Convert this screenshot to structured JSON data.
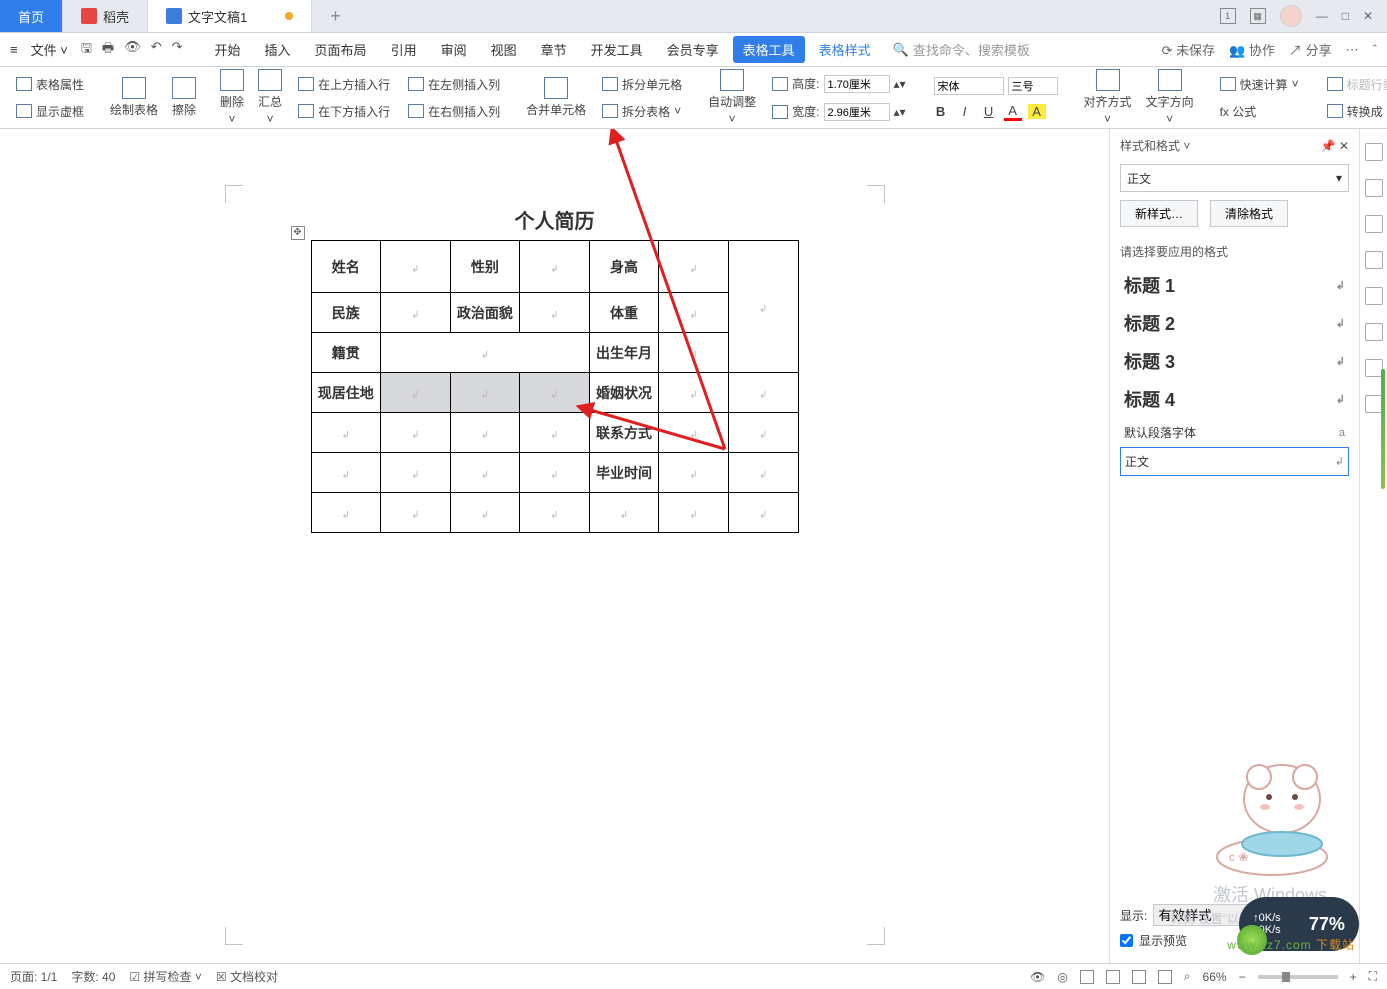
{
  "tabs": {
    "home": "首页",
    "docell": "稻壳",
    "doc": "文字文稿1",
    "add": "+"
  },
  "titlebar_right": {
    "box_num": "1"
  },
  "menubar": {
    "file": "文件",
    "items": [
      "开始",
      "插入",
      "页面布局",
      "引用",
      "审阅",
      "视图",
      "章节",
      "开发工具",
      "会员专享",
      "表格工具",
      "表格样式"
    ],
    "search_ph": "查找命令、搜索模板",
    "right": {
      "unsaved": "未保存",
      "coop": "协作",
      "share": "分享"
    }
  },
  "ribbon": {
    "table_attr": "表格属性",
    "show_border": "显示虚框",
    "draw": "绘制表格",
    "erase": "擦除",
    "delete": "删除",
    "summary": "汇总",
    "ins_top": "在上方插入行",
    "ins_bottom": "在下方插入行",
    "ins_left": "在左侧插入列",
    "ins_right": "在右侧插入列",
    "merge": "合并单元格",
    "split_cell": "拆分单元格",
    "split_table": "拆分表格",
    "auto_adjust": "自动调整",
    "height_lbl": "高度:",
    "height_val": "1.70厘米",
    "width_lbl": "宽度:",
    "width_val": "2.96厘米",
    "font_name": "宋体",
    "font_size": "三号",
    "align": "对齐方式",
    "text_dir": "文字方向",
    "formula": "fx 公式",
    "quick_calc": "快速计算",
    "title_row": "标题行重",
    "convert": "转换成"
  },
  "doc": {
    "title": "个人简历",
    "rows": [
      [
        "姓名",
        "",
        "性别",
        "",
        "身高",
        "",
        ""
      ],
      [
        "民族",
        "",
        "政治面貌",
        "",
        "体重",
        "",
        ""
      ],
      [
        "籍贯",
        "",
        "",
        "",
        "出生年月",
        "",
        ""
      ],
      [
        "现居住地",
        "",
        "",
        "",
        "婚姻状况",
        "",
        ""
      ],
      [
        "",
        "",
        "",
        "",
        "联系方式",
        "",
        ""
      ],
      [
        "",
        "",
        "",
        "",
        "毕业时间",
        "",
        ""
      ],
      [
        "",
        "",
        "",
        "",
        "",
        "",
        ""
      ]
    ]
  },
  "panel": {
    "title": "样式和格式",
    "current": "正文",
    "new_btn": "新样式…",
    "clear_btn": "清除格式",
    "hint": "请选择要应用的格式",
    "styles": [
      "标题 1",
      "标题 2",
      "标题 3",
      "标题 4"
    ],
    "default_font": "默认段落字体",
    "default_mark": "a",
    "selected": "正文",
    "show_lbl": "显示:",
    "show_val": "有效样式",
    "preview_chk": "显示预览"
  },
  "status": {
    "page": "页面: 1/1",
    "words": "字数: 40",
    "spell": "拼写检查",
    "proof": "文档校对",
    "zoom": "66%"
  },
  "overlay": {
    "activate": "激活 Windows",
    "activate_sub": "转到\"设置\"以激活 Windows。",
    "pill_net": "0K/s",
    "pill_pct": "77%",
    "site": "www.xz7.com",
    "site_label": "下载站"
  }
}
